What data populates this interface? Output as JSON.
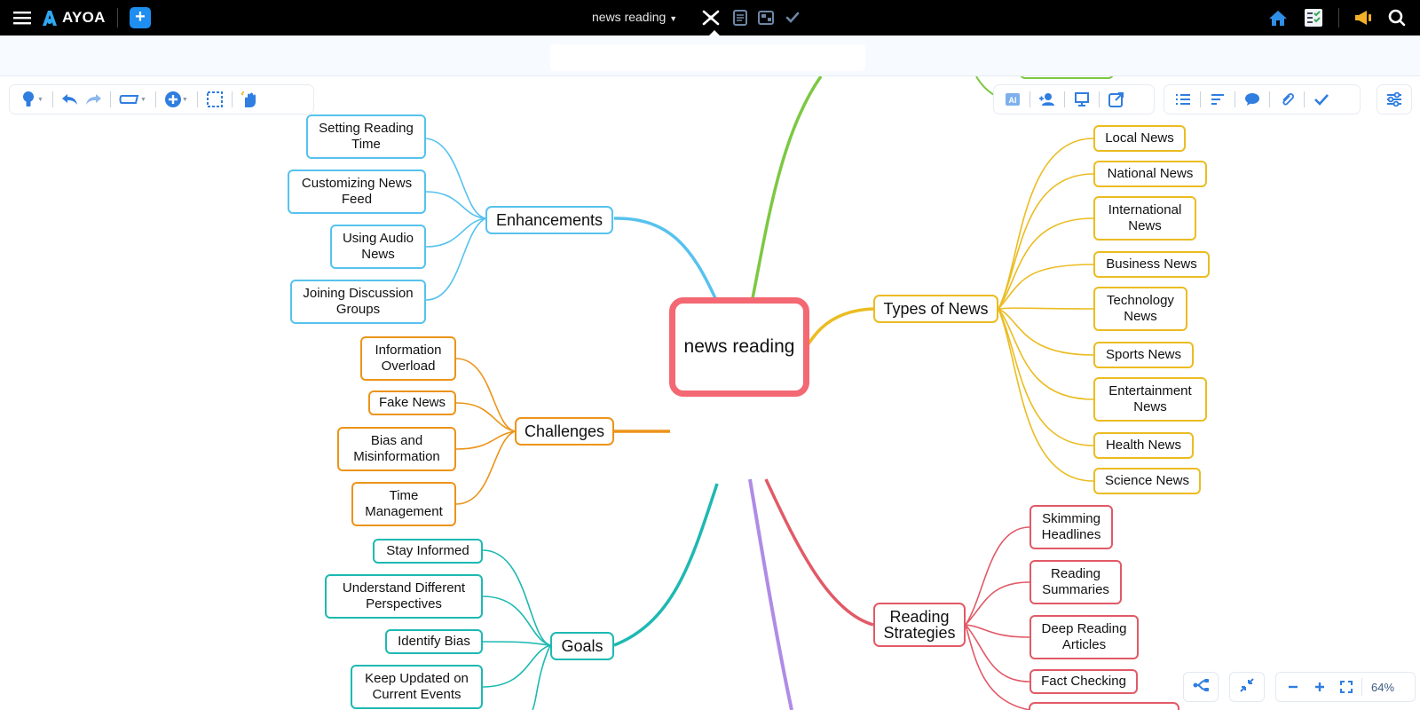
{
  "app": {
    "name": "AYOA"
  },
  "toolbar": {
    "document_title": "news reading"
  },
  "map": {
    "central": "news reading",
    "branches": {
      "enhancements": {
        "label": "Enhancements",
        "children": [
          "Setting Reading Time",
          "Customizing News Feed",
          "Using Audio News",
          "Joining Discussion Groups"
        ]
      },
      "challenges": {
        "label": "Challenges",
        "children": [
          "Information Overload",
          "Fake News",
          "Bias and Misinformation",
          "Time Management"
        ]
      },
      "goals": {
        "label": "Goals",
        "children": [
          "Stay Informed",
          "Understand Different Perspectives",
          "Identify Bias",
          "Keep Updated on Current Events"
        ]
      },
      "types": {
        "label": "Types of News",
        "children": [
          "Local News",
          "National News",
          "International News",
          "Business News",
          "Technology News",
          "Sports News",
          "Entertainment News",
          "Health News",
          "Science News"
        ]
      },
      "strategies": {
        "label": "Reading Strategies",
        "children": [
          "Skimming Headlines",
          "Reading Summaries",
          "Deep Reading Articles",
          "Fact Checking"
        ]
      }
    }
  },
  "zoom": {
    "level": "64%"
  },
  "colors": {
    "enhancements": "#56c2ee",
    "challenges": "#ec9419",
    "goals": "#1db9b2",
    "types": "#ebbc21",
    "strategies": "#e15a67",
    "green_branch": "#7cc843",
    "purple_branch": "#b08be6",
    "accent": "#1e8ef0"
  },
  "icons": {
    "topbar": [
      "hamburger-icon",
      "ayoa-logo-icon",
      "add-icon",
      "mindmap-view-icon",
      "document-view-icon",
      "canvas-view-icon",
      "task-view-icon",
      "home-icon",
      "checklist-icon",
      "announcement-icon",
      "search-icon"
    ],
    "left_toolbar": [
      "lightbulb-icon",
      "undo-icon",
      "redo-icon",
      "shape-icon",
      "add-circle-icon",
      "select-area-icon",
      "magic-hand-icon"
    ],
    "right_toolbar": [
      "ai-icon",
      "assign-user-icon",
      "present-icon",
      "export-icon",
      "list-icon",
      "sort-icon",
      "comment-icon",
      "attachment-icon",
      "check-icon",
      "settings-sliders-icon"
    ]
  }
}
